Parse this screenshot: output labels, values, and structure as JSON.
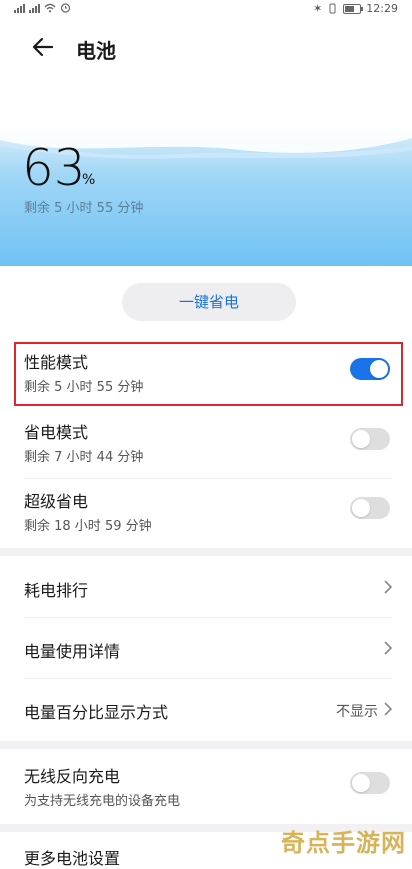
{
  "status_bar": {
    "time": "12:29"
  },
  "header": {
    "title": "电池"
  },
  "battery": {
    "level_number": "63",
    "level_symbol": "%",
    "remaining": "剩余 5 小时 55 分钟",
    "fill_fraction": 0.63
  },
  "save_button": {
    "label": "一键省电"
  },
  "modes": [
    {
      "title": "性能模式",
      "subtitle": "剩余 5 小时 55 分钟",
      "enabled": true
    },
    {
      "title": "省电模式",
      "subtitle": "剩余 7 小时 44 分钟",
      "enabled": false
    },
    {
      "title": "超级省电",
      "subtitle": "剩余 18 小时 59 分钟",
      "enabled": false
    }
  ],
  "list": [
    {
      "label": "耗电排行"
    },
    {
      "label": "电量使用详情"
    },
    {
      "label": "电量百分比显示方式",
      "value": "不显示"
    }
  ],
  "wireless": {
    "title": "无线反向充电",
    "subtitle": "为支持无线充电的设备充电",
    "enabled": false
  },
  "more": {
    "label": "更多电池设置"
  },
  "watermark": "奇点手游网",
  "colors": {
    "accent": "#1a73e8",
    "highlight_border": "#e0262c",
    "hero_blue": "#6fc2f3"
  }
}
